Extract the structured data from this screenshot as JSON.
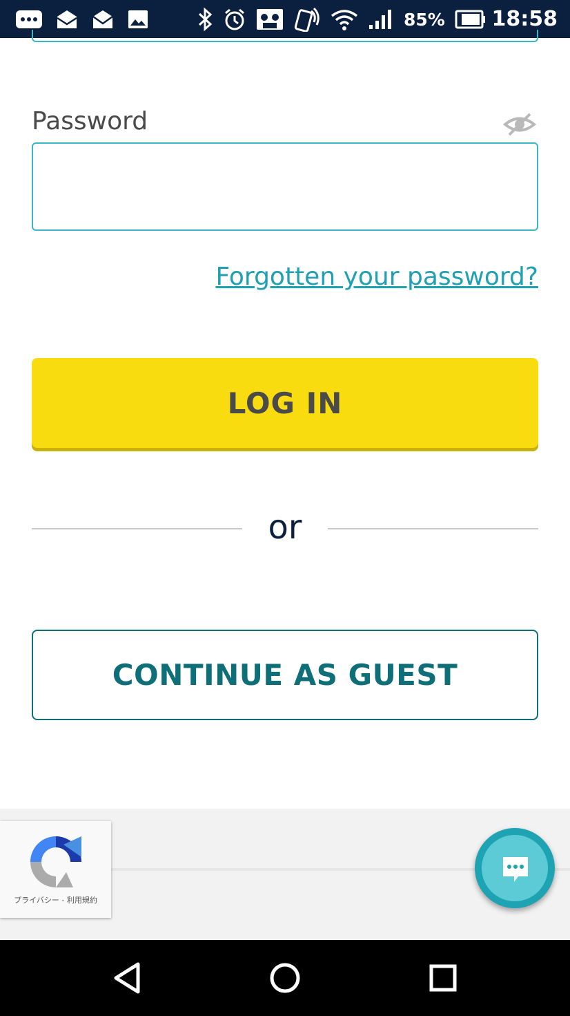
{
  "status_bar": {
    "battery": "85%",
    "time": "18:58"
  },
  "login_form": {
    "password_label": "Password",
    "password_value": "",
    "forgot_link": "Forgotten your password?",
    "login_button": "LOG IN",
    "divider_text": "or",
    "guest_button": "CONTINUE AS GUEST"
  },
  "recaptcha": {
    "links": "プライバシー - 利用規約"
  },
  "colors": {
    "accent_teal": "#3bb6c5",
    "login_yellow": "#f8dc0f",
    "guest_teal": "#0f6f79",
    "navy": "#0b1f3f"
  }
}
